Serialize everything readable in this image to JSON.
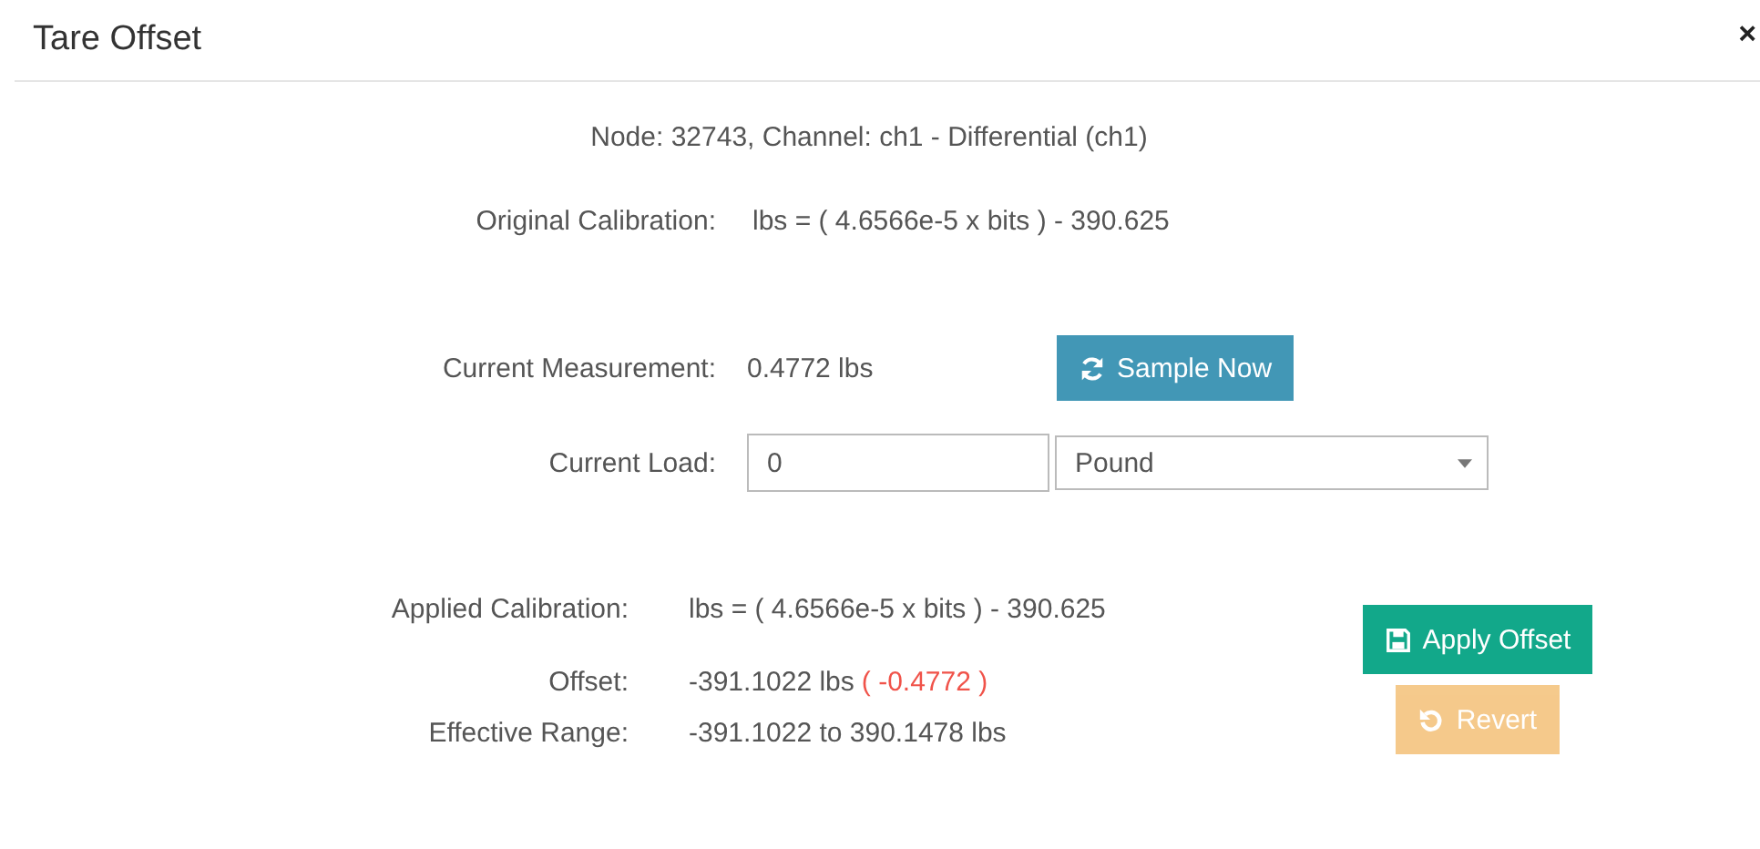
{
  "dialog": {
    "title": "Tare Offset",
    "close": "×"
  },
  "node_info": "Node: 32743, Channel: ch1 - Differential (ch1)",
  "original_calibration": {
    "label": "Original Calibration:",
    "value": "lbs = ( 4.6566e-5 x bits ) - 390.625"
  },
  "current_measurement": {
    "label": "Current Measurement:",
    "value": "0.4772 lbs"
  },
  "sample_button": {
    "label": "Sample Now"
  },
  "current_load": {
    "label": "Current Load:",
    "value": "0"
  },
  "unit_select": {
    "value": "Pound"
  },
  "applied_calibration": {
    "label": "Applied Calibration:",
    "value": "lbs = ( 4.6566e-5 x bits ) - 390.625"
  },
  "offset": {
    "label": "Offset:",
    "value": "-391.1022 lbs",
    "delta": "( -0.4772 )"
  },
  "effective_range": {
    "label": "Effective Range:",
    "value": "-391.1022 to 390.1478 lbs"
  },
  "buttons": [
    {
      "label": "Apply Offset",
      "kind": "save",
      "disabled": false
    },
    {
      "label": "Revert",
      "kind": "revert",
      "disabled": true
    }
  ]
}
